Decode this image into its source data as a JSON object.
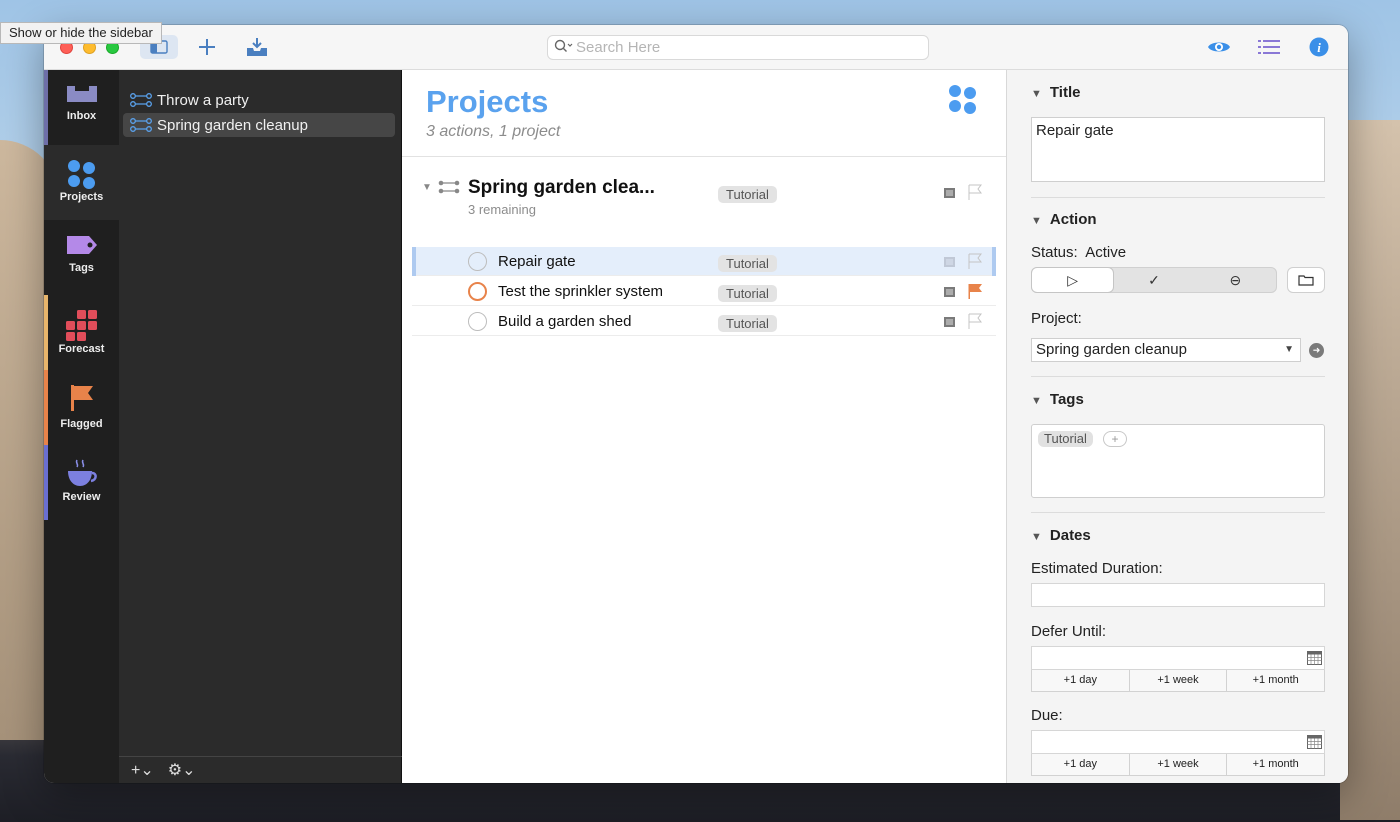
{
  "tooltip": "Show or hide the sidebar",
  "toolbar": {
    "search_placeholder": "Search Here",
    "sidebar_toggle_icon": "sidebar-icon",
    "add_icon": "plus-icon",
    "inbox_icon": "inbox-download-icon",
    "view_icon": "eye-icon",
    "list_icon": "list-icon",
    "info_icon": "info-icon"
  },
  "perspectives": [
    {
      "label": "Inbox",
      "icon": "inbox-icon",
      "color": "#6e6fa8"
    },
    {
      "label": "Projects",
      "icon": "projects-icon",
      "color": "#4c9cf0"
    },
    {
      "label": "Tags",
      "icon": "tag-icon",
      "color": "#a57bd6"
    },
    {
      "label": "Forecast",
      "icon": "forecast-icon",
      "color": "#e14d5a"
    },
    {
      "label": "Flagged",
      "icon": "flag-icon",
      "color": "#e8834a"
    },
    {
      "label": "Review",
      "icon": "review-icon",
      "color": "#6a6fd1"
    }
  ],
  "sidebar": {
    "items": [
      {
        "label": "Throw a party"
      },
      {
        "label": "Spring garden cleanup"
      }
    ],
    "footer_add": "+⌄",
    "footer_gear": "⚙⌄"
  },
  "main": {
    "title": "Projects",
    "subtitle": "3 actions, 1 project",
    "group": {
      "title": "Spring garden clea...",
      "remaining": "3 remaining",
      "tag": "Tutorial"
    },
    "tasks": [
      {
        "title": "Repair gate",
        "tag": "Tutorial",
        "flagged": false,
        "selected": true
      },
      {
        "title": "Test the sprinkler system",
        "tag": "Tutorial",
        "flagged": true,
        "selected": false
      },
      {
        "title": "Build a garden shed",
        "tag": "Tutorial",
        "flagged": false,
        "selected": false
      }
    ]
  },
  "inspector": {
    "title_section": "Title",
    "title_value": "Repair gate",
    "action_section": "Action",
    "status_label": "Status:",
    "status_value": "Active",
    "status_options": [
      "▷",
      "✓",
      "⊖"
    ],
    "project_label": "Project:",
    "project_value": "Spring garden cleanup",
    "tags_section": "Tags",
    "tag_value": "Tutorial",
    "tag_add": "+",
    "dates_section": "Dates",
    "estimated_label": "Estimated Duration:",
    "defer_label": "Defer Until:",
    "due_label": "Due:",
    "quick": [
      "+1 day",
      "+1 week",
      "+1 month"
    ]
  },
  "colors": {
    "accent": "#5aa2ee",
    "flag": "#e8834a"
  }
}
